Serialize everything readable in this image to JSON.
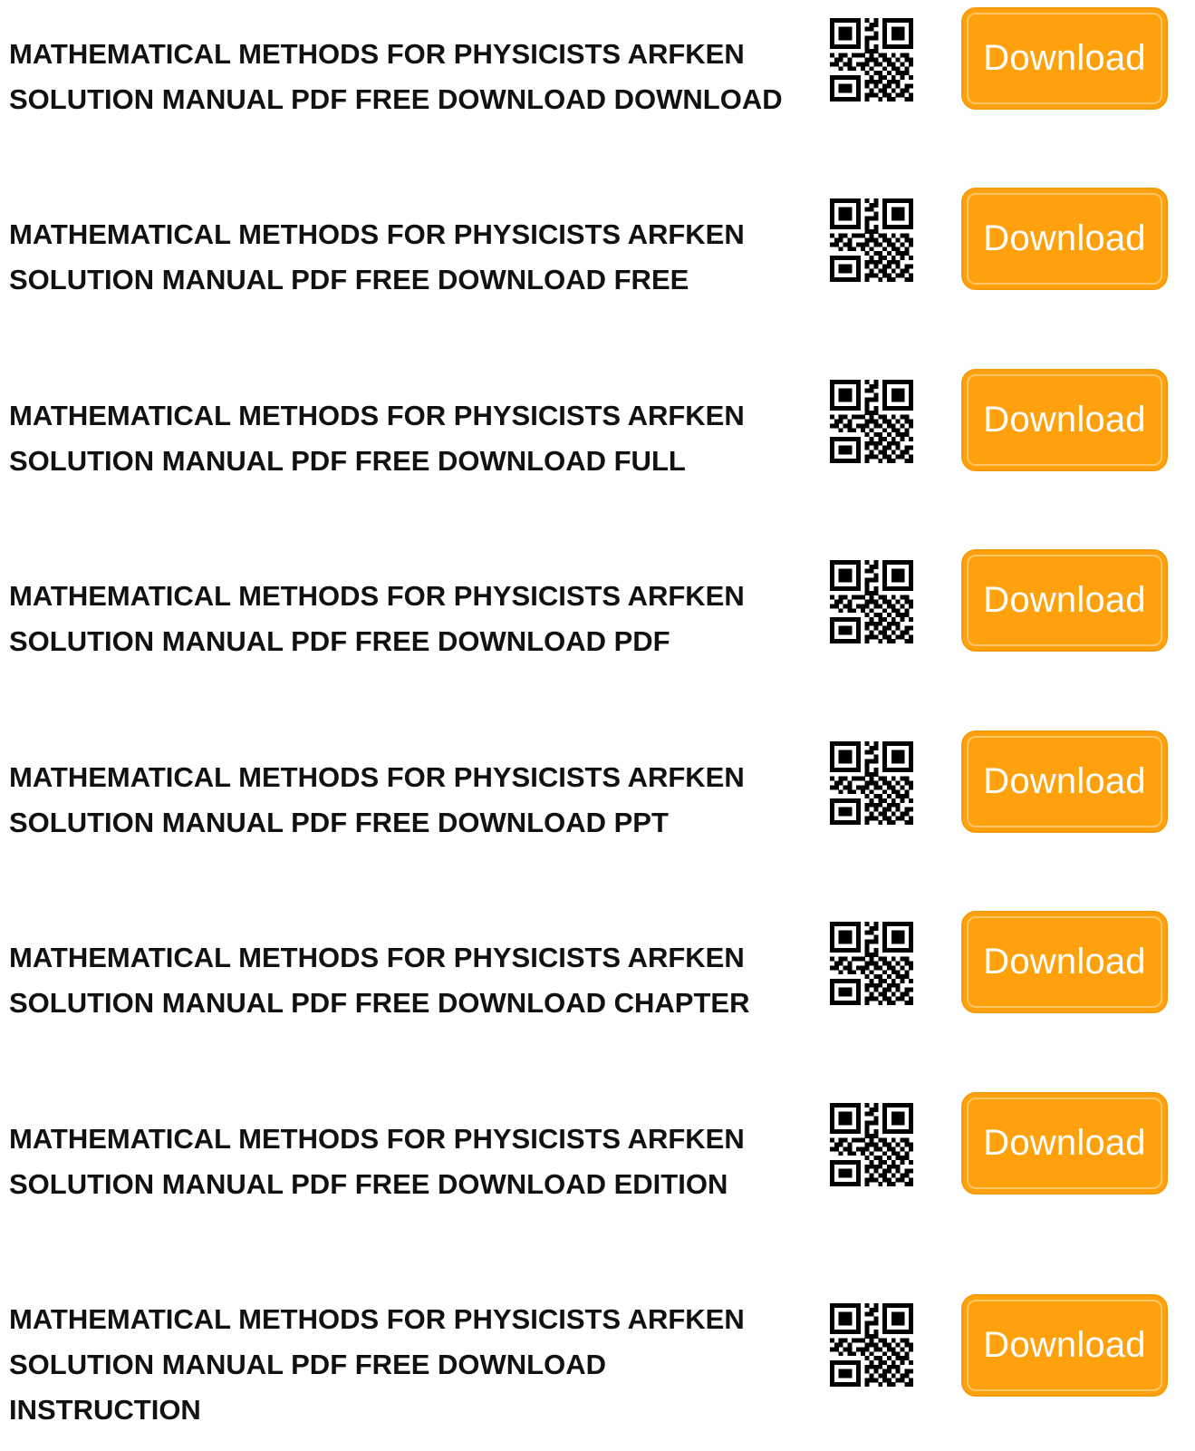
{
  "items": [
    {
      "line1": "MATHEMATICAL METHODS FOR PHYSICISTS ARFKEN",
      "line2": "SOLUTION MANUAL PDF FREE DOWNLOAD DOWNLOAD",
      "line3": "",
      "button_label": "Download"
    },
    {
      "line1": "MATHEMATICAL METHODS FOR PHYSICISTS ARFKEN",
      "line2": "SOLUTION MANUAL PDF FREE DOWNLOAD FREE",
      "line3": "",
      "button_label": "Download"
    },
    {
      "line1": "MATHEMATICAL METHODS FOR PHYSICISTS ARFKEN",
      "line2": "SOLUTION MANUAL PDF FREE DOWNLOAD FULL",
      "line3": "",
      "button_label": "Download"
    },
    {
      "line1": "MATHEMATICAL METHODS FOR PHYSICISTS ARFKEN",
      "line2": "SOLUTION MANUAL PDF FREE DOWNLOAD PDF",
      "line3": "",
      "button_label": "Download"
    },
    {
      "line1": "MATHEMATICAL METHODS FOR PHYSICISTS ARFKEN",
      "line2": "SOLUTION MANUAL PDF FREE DOWNLOAD PPT",
      "line3": "",
      "button_label": "Download"
    },
    {
      "line1": "MATHEMATICAL METHODS FOR PHYSICISTS ARFKEN",
      "line2": "SOLUTION MANUAL PDF FREE DOWNLOAD CHAPTER",
      "line3": "",
      "button_label": "Download"
    },
    {
      "line1": "MATHEMATICAL METHODS FOR PHYSICISTS ARFKEN",
      "line2": "SOLUTION MANUAL PDF FREE DOWNLOAD EDITION",
      "line3": "",
      "button_label": "Download"
    },
    {
      "line1": "MATHEMATICAL METHODS FOR PHYSICISTS ARFKEN",
      "line2": "SOLUTION MANUAL PDF FREE DOWNLOAD",
      "line3": "INSTRUCTION",
      "button_label": "Download"
    }
  ],
  "qr_icon": "qr-code-icon",
  "colors": {
    "button_fill": "#ffa10c",
    "button_text": "#ffffff",
    "title_text": "#111111"
  }
}
